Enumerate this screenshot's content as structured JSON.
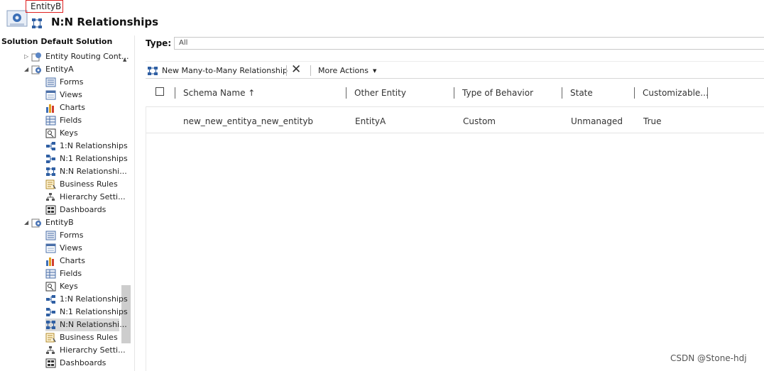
{
  "header": {
    "entity_tag": "EntityB",
    "page_title": "N:N Relationships"
  },
  "sidebar": {
    "title": "Solution Default Solution",
    "items": [
      {
        "label": "Entity Routing Cont...",
        "icon": "entity-routing-icon"
      },
      {
        "label": "EntityA",
        "icon": "entity-icon"
      },
      {
        "label": "Forms",
        "icon": "forms-icon"
      },
      {
        "label": "Views",
        "icon": "views-icon"
      },
      {
        "label": "Charts",
        "icon": "charts-icon"
      },
      {
        "label": "Fields",
        "icon": "fields-icon"
      },
      {
        "label": "Keys",
        "icon": "keys-icon"
      },
      {
        "label": "1:N Relationships",
        "icon": "one-to-many-icon"
      },
      {
        "label": "N:1 Relationships",
        "icon": "many-to-one-icon"
      },
      {
        "label": "N:N Relationshi...",
        "icon": "many-to-many-icon"
      },
      {
        "label": "Business Rules",
        "icon": "business-rules-icon"
      },
      {
        "label": "Hierarchy Setti...",
        "icon": "hierarchy-icon"
      },
      {
        "label": "Dashboards",
        "icon": "dashboards-icon"
      },
      {
        "label": "EntityB",
        "icon": "entity-icon"
      },
      {
        "label": "Forms",
        "icon": "forms-icon"
      },
      {
        "label": "Views",
        "icon": "views-icon"
      },
      {
        "label": "Charts",
        "icon": "charts-icon"
      },
      {
        "label": "Fields",
        "icon": "fields-icon"
      },
      {
        "label": "Keys",
        "icon": "keys-icon"
      },
      {
        "label": "1:N Relationships",
        "icon": "one-to-many-icon"
      },
      {
        "label": "N:1 Relationships",
        "icon": "many-to-one-icon"
      },
      {
        "label": "N:N Relationshi...",
        "icon": "many-to-many-icon"
      },
      {
        "label": "Business Rules",
        "icon": "business-rules-icon"
      },
      {
        "label": "Hierarchy Setti...",
        "icon": "hierarchy-icon"
      },
      {
        "label": "Dashboards",
        "icon": "dashboards-icon"
      }
    ]
  },
  "filter": {
    "label": "Type:",
    "value": "All"
  },
  "toolbar": {
    "new_label": "New Many-to-Many Relationship",
    "delete_icon": "delete-x-icon",
    "more_actions_label": "More Actions"
  },
  "grid": {
    "columns": [
      "Schema Name ↑",
      "Other Entity",
      "Type of Behavior",
      "State",
      "Customizable..."
    ],
    "rows": [
      [
        "new_new_entitya_new_entityb",
        "EntityA",
        "Custom",
        "Unmanaged",
        "True"
      ]
    ]
  },
  "watermark": "CSDN @Stone-hdj",
  "colors": {
    "tag_border": "#e02020",
    "selected_bg": "#d9d9d9"
  }
}
